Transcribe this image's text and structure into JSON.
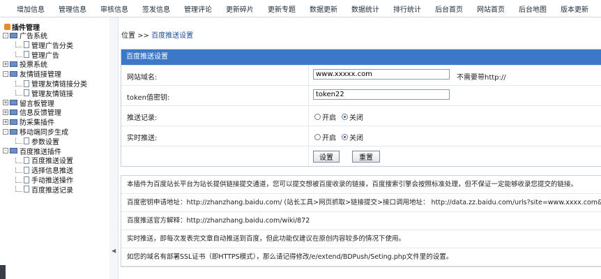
{
  "topnav": [
    "增加信息",
    "管理信息",
    "审核信息",
    "签发信息",
    "管理评论",
    "更新碎片",
    "更新专题",
    "数据更新",
    "数据统计",
    "排行统计",
    "后台首页",
    "网站首页",
    "后台地图",
    "版本更新"
  ],
  "sidebar": {
    "root": "插件管理",
    "items": [
      {
        "label": "广告系统",
        "toggle": "-",
        "kind": "folder"
      },
      {
        "label": "管理广告分类",
        "kind": "page"
      },
      {
        "label": "管理广告",
        "kind": "page"
      },
      {
        "label": "投票系统",
        "toggle": "+",
        "kind": "folder"
      },
      {
        "label": "友情链接管理",
        "toggle": "-",
        "kind": "folder"
      },
      {
        "label": "管理友情链接分类",
        "kind": "page"
      },
      {
        "label": "管理友情链接",
        "kind": "page"
      },
      {
        "label": "留言板管理",
        "toggle": "+",
        "kind": "folder"
      },
      {
        "label": "信息反馈管理",
        "toggle": "+",
        "kind": "folder"
      },
      {
        "label": "防采集插件",
        "toggle": "+",
        "kind": "folder"
      },
      {
        "label": "移动端同步生成",
        "toggle": "-",
        "kind": "folder"
      },
      {
        "label": "参数设置",
        "kind": "page"
      },
      {
        "label": "百度推送插件",
        "toggle": "-",
        "kind": "folder"
      },
      {
        "label": "百度推送设置",
        "kind": "page"
      },
      {
        "label": "选择信息推送",
        "kind": "page"
      },
      {
        "label": "手动推送操作",
        "kind": "page"
      },
      {
        "label": "百度推送记录",
        "kind": "page"
      }
    ]
  },
  "breadcrumb": {
    "prefix": "位置 >>",
    "link": "百度推送设置"
  },
  "form": {
    "title": "百度推送设置",
    "site_label": "网站域名:",
    "site_value": "www.xxxxx.com",
    "site_hint": "不需要带http://",
    "token_label": "token值密钥:",
    "token_value": "token22",
    "record_label": "推送记录:",
    "realtime_label": "实时推送:",
    "on_label": "开启",
    "off_label": "关闭",
    "submit_label": "设置",
    "reset_label": "重置"
  },
  "info": [
    "本插件为百度站长平台为站长提供链接提交通道，您可以提交想被百度收录的链接，百度搜索引擎会按照标准处理，但不保证一定能够收录您提交的链接。",
    "百度密钥申请地址：http://zhanzhang.baidu.com/ (站长工具>网页抓取>链接提交>接口调用地址： http://data.zz.baidu.com/urls?site=www.xxxx.com&token=toke",
    "百度推送官方解释：http://zhanzhang.baidu.com/wiki/872",
    "实时推送，即每次发表完文章自动推送到百度，但此功能仅建议在原创内容较多的情况下使用。",
    "如您的域名有部署SSL证书（即HTTPS模式），那么请记得修改/e/extend/BDPush/Seting.php文件里的设置。"
  ]
}
